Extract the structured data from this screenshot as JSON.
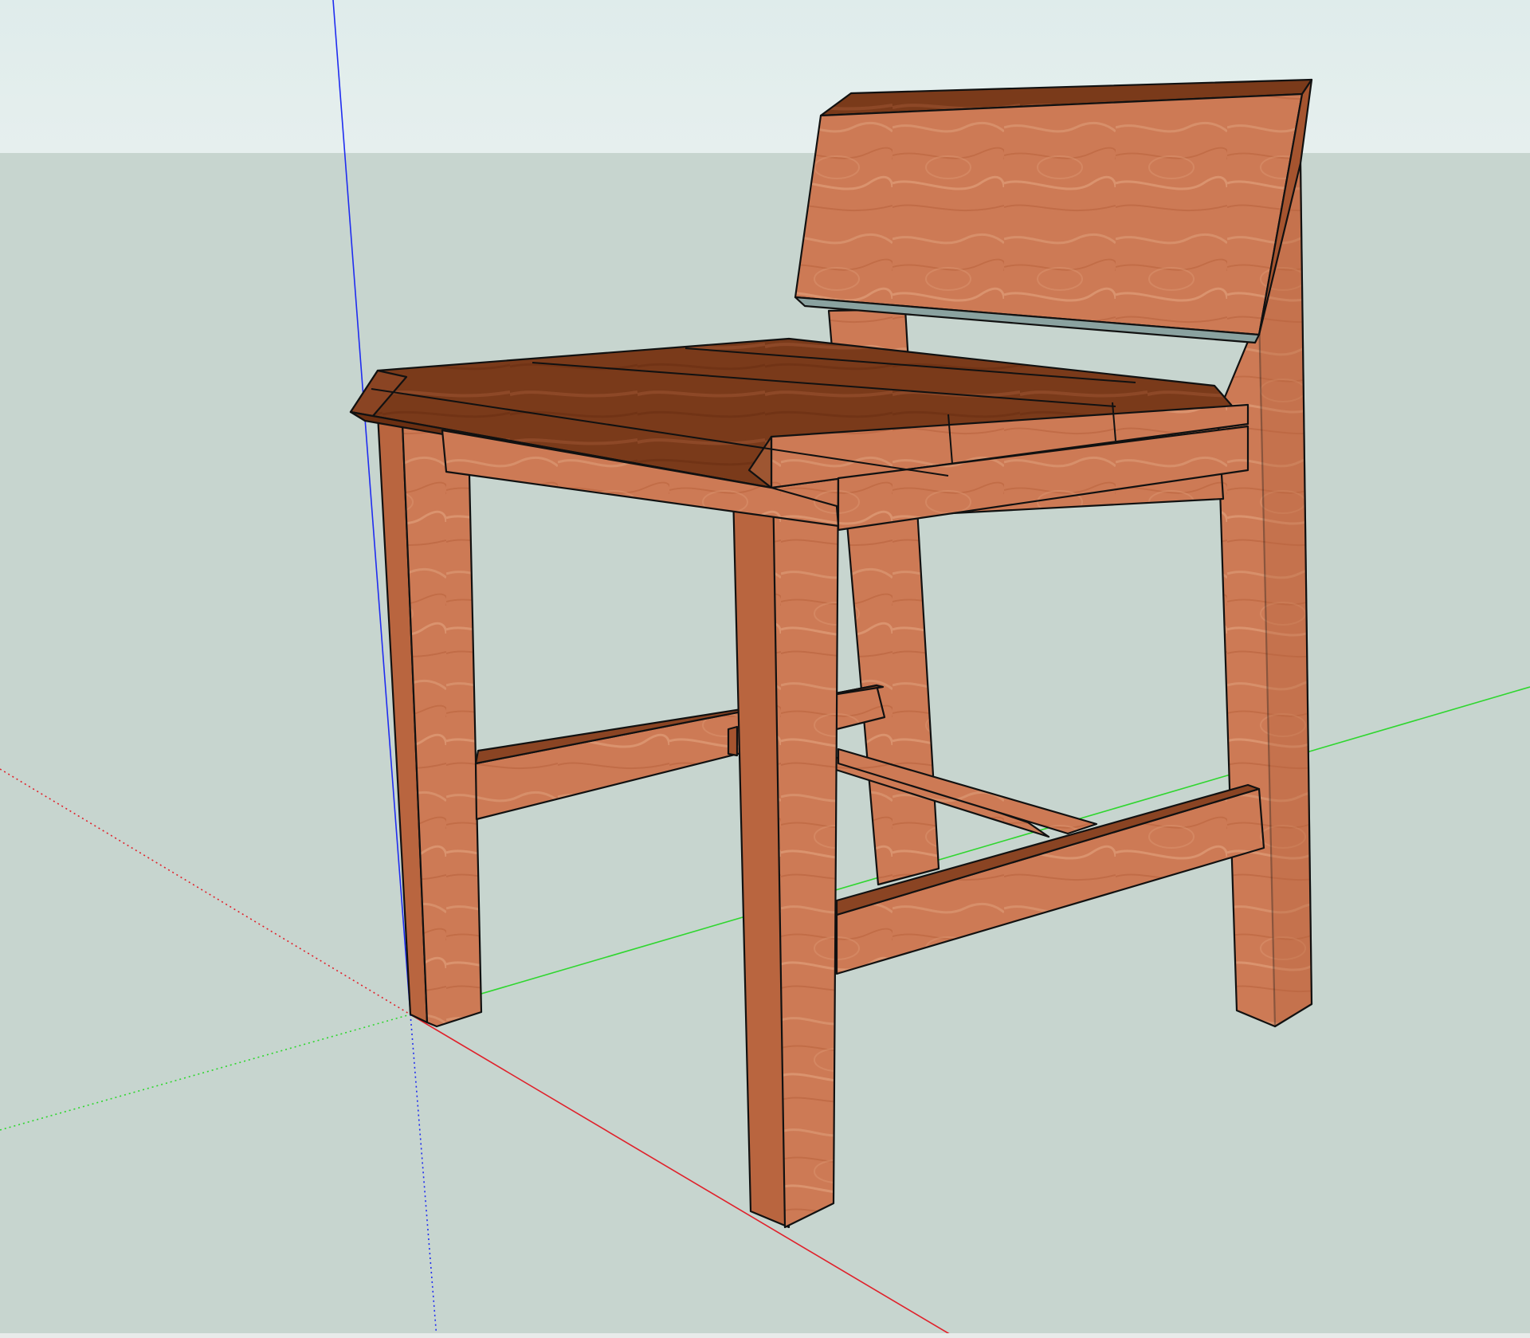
{
  "viewport": {
    "sky_color": "#e6efee",
    "ground_color": "#c7d5cf",
    "status_strip_color": "#e8ebea"
  },
  "axes": {
    "red": "#e0212b",
    "green": "#2fd62f",
    "blue": "#1f2cf0"
  },
  "model": {
    "wood_light": "#cd7a55",
    "wood_mid": "#b9653f",
    "wood_dark": "#8a4423",
    "wood_top": "#7a3a1a",
    "edge_color": "#111111",
    "glass_color": "#8aa2a0"
  }
}
